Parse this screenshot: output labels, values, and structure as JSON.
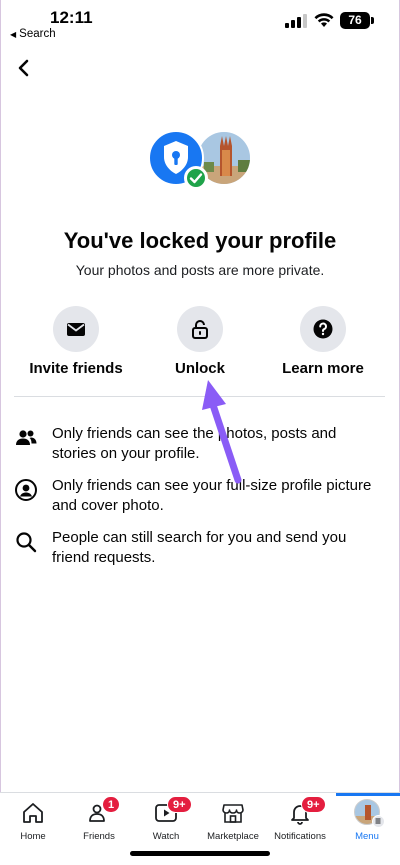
{
  "status_bar": {
    "time": "12:11",
    "back_app": "Search",
    "battery": "76"
  },
  "header": {
    "back_icon": "chevron-left-icon"
  },
  "profile": {
    "title": "You've locked your profile",
    "subtitle": "Your photos and posts are more private."
  },
  "actions": [
    {
      "label": "Invite friends",
      "icon": "envelope-icon"
    },
    {
      "label": "Unlock",
      "icon": "unlock-icon"
    },
    {
      "label": "Learn more",
      "icon": "question-icon"
    }
  ],
  "info": [
    {
      "icon": "friends-icon",
      "text": "Only friends can see the photos, posts and stories on your profile."
    },
    {
      "icon": "person-circle-icon",
      "text": "Only friends can see your full-size profile picture and cover photo."
    },
    {
      "icon": "search-icon",
      "text": "People can still search for you and send you friend requests."
    }
  ],
  "bottom_nav": {
    "tabs": [
      {
        "label": "Home",
        "badge": ""
      },
      {
        "label": "Friends",
        "badge": "1"
      },
      {
        "label": "Watch",
        "badge": "9+"
      },
      {
        "label": "Marketplace",
        "badge": ""
      },
      {
        "label": "Notifications",
        "badge": "9+"
      },
      {
        "label": "Menu",
        "badge": ""
      }
    ],
    "active_tab": "Menu"
  },
  "colors": {
    "accent": "#1877f2",
    "badge": "#e41e3f",
    "check": "#1fa34a",
    "arrow": "#8a5cf6"
  }
}
